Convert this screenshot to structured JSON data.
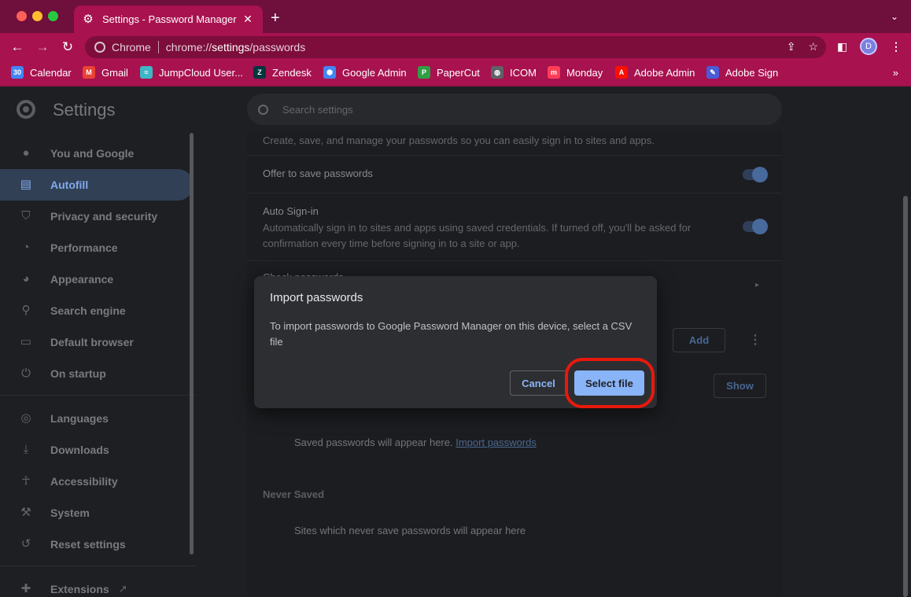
{
  "browser": {
    "tab_title": "Settings - Password Manager",
    "site_label": "Chrome",
    "url_prefix": "chrome://",
    "url_host": "settings",
    "url_path": "/passwords",
    "avatar_letter": "D",
    "bookmarks": [
      {
        "label": "Calendar",
        "icon": "calendar-icon",
        "color": "#4285f4",
        "glyph": "30"
      },
      {
        "label": "Gmail",
        "icon": "gmail-icon",
        "color": "#ea4335",
        "glyph": "M"
      },
      {
        "label": "JumpCloud User...",
        "icon": "jumpcloud-icon",
        "color": "#3fb6c5",
        "glyph": "≈"
      },
      {
        "label": "Zendesk",
        "icon": "zendesk-icon",
        "color": "#03363d",
        "glyph": "Z"
      },
      {
        "label": "Google Admin",
        "icon": "google-admin-icon",
        "color": "#4285f4",
        "glyph": "⬢"
      },
      {
        "label": "PaperCut",
        "icon": "papercut-icon",
        "color": "#2f9e44",
        "glyph": "P"
      },
      {
        "label": "ICOM",
        "icon": "globe-icon",
        "color": "#5f6368",
        "glyph": "◍"
      },
      {
        "label": "Monday",
        "icon": "monday-icon",
        "color": "#ff3d57",
        "glyph": "m"
      },
      {
        "label": "Adobe Admin",
        "icon": "adobe-icon",
        "color": "#fa0f00",
        "glyph": "A"
      },
      {
        "label": "Adobe Sign",
        "icon": "adobe-sign-icon",
        "color": "#4b5bd6",
        "glyph": "✎"
      }
    ]
  },
  "header": {
    "title": "Settings",
    "search_placeholder": "Search settings"
  },
  "sidebar": {
    "items": [
      {
        "label": "You and Google",
        "icon": "person-icon",
        "active": false
      },
      {
        "label": "Autofill",
        "icon": "clipboard-icon",
        "active": true
      },
      {
        "label": "Privacy and security",
        "icon": "shield-icon",
        "active": false
      },
      {
        "label": "Performance",
        "icon": "speedometer-icon",
        "active": false
      },
      {
        "label": "Appearance",
        "icon": "palette-icon",
        "active": false
      },
      {
        "label": "Search engine",
        "icon": "search-icon",
        "active": false
      },
      {
        "label": "Default browser",
        "icon": "browser-icon",
        "active": false
      },
      {
        "label": "On startup",
        "icon": "power-icon",
        "active": false
      },
      {
        "label": "Languages",
        "icon": "globe-icon",
        "active": false
      },
      {
        "label": "Downloads",
        "icon": "download-icon",
        "active": false
      },
      {
        "label": "Accessibility",
        "icon": "accessibility-icon",
        "active": false
      },
      {
        "label": "System",
        "icon": "wrench-icon",
        "active": false
      },
      {
        "label": "Reset settings",
        "icon": "history-icon",
        "active": false
      },
      {
        "label": "Extensions",
        "icon": "puzzle-icon",
        "active": false
      }
    ]
  },
  "content": {
    "intro": "Create, save, and manage your passwords so you can easily sign in to sites and apps.",
    "offer_save": "Offer to save passwords",
    "auto_signin_title": "Auto Sign-in",
    "auto_signin_desc": "Automatically sign in to sites and apps using saved credentials. If turned off, you'll be asked for confirmation every time before signing in to a site or app.",
    "check_passwords": "Check passwords",
    "add_button": "Add",
    "show_button": "Show",
    "saved_empty": "Saved passwords will appear here.",
    "import_link": "Import passwords",
    "never_saved_title": "Never Saved",
    "never_saved_empty": "Sites which never save passwords will appear here"
  },
  "dialog": {
    "title": "Import passwords",
    "body": "To import passwords to Google Password Manager on this device, select a CSV file",
    "cancel_label": "Cancel",
    "select_label": "Select file"
  }
}
